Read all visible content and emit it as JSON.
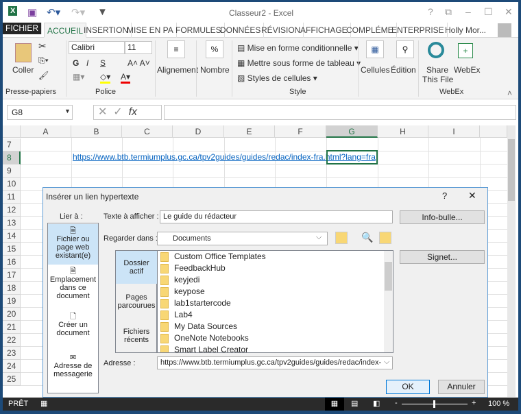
{
  "window": {
    "title": "Classeur2 - Excel",
    "controls": [
      "?",
      "⧉",
      "–",
      "☐",
      "✕"
    ]
  },
  "tabs": [
    "FICHIER",
    "ACCUEIL",
    "INSERTION",
    "MISE EN PA",
    "FORMULES",
    "DONNÉES",
    "RÉVISION",
    "AFFICHAGE",
    "COMPLÉME",
    "ENTERPRISE"
  ],
  "user": "Holly Mor...",
  "ribbon": {
    "paste": "Coller",
    "clipboard_group": "Presse-papiers",
    "font": "Calibri",
    "size": "11",
    "font_group": "Police",
    "bold": "G",
    "italic": "I",
    "underline": "S",
    "alignment": "Alignement",
    "number": "Nombre",
    "cond_format": "Mise en forme conditionnelle",
    "table_format": "Mettre sous forme de tableau",
    "cell_styles": "Styles de cellules",
    "style_group": "Style",
    "cells": "Cellules",
    "editing": "Édition",
    "share1": "Share",
    "share2": "This File",
    "webex": "WebEx",
    "webex_group": "WebEx"
  },
  "formula_bar": {
    "name_box": "G8",
    "value": ""
  },
  "columns": [
    "A",
    "B",
    "C",
    "D",
    "E",
    "F",
    "G",
    "H",
    "I"
  ],
  "rows": [
    "7",
    "8",
    "9",
    "10",
    "11",
    "12",
    "13",
    "14",
    "15",
    "16",
    "17",
    "18",
    "19",
    "20",
    "21",
    "22",
    "23",
    "24",
    "25"
  ],
  "cell_b8": "https://www.btb.termiumplus.gc.ca/tpv2guides/guides/redac/index-fra.html?lang=fra",
  "dialog": {
    "title": "Insérer un lien hypertexte",
    "help": "?",
    "close": "✕",
    "link_to": "Lier à :",
    "link_items": [
      [
        "Fichier ou",
        "page web",
        "existant(e)"
      ],
      [
        "Emplacement",
        "dans ce",
        "document"
      ],
      [
        "Créer un",
        "document"
      ],
      [
        "Adresse de",
        "messagerie"
      ]
    ],
    "text_label": "Texte à afficher :",
    "text_value": "Le guide du rédacteur",
    "tooltip_btn": "Info-bulle...",
    "look_in_label": "Regarder dans :",
    "look_in_value": "Documents",
    "nav": [
      [
        "Dossier",
        "actif"
      ],
      [
        "Pages",
        "parcourues"
      ],
      [
        "Fichiers",
        "récents"
      ]
    ],
    "files": [
      "Custom Office Templates",
      "FeedbackHub",
      "keyjedi",
      "keypose",
      "lab1startercode",
      "Lab4",
      "My Data Sources",
      "OneNote Notebooks",
      "Smart Label Creator"
    ],
    "bookmark_btn": "Signet...",
    "address_label": "Adresse :",
    "address_value": "https://www.btb.termiumplus.gc.ca/tpv2guides/guides/redac/index-",
    "ok": "OK",
    "cancel": "Annuler"
  },
  "status": {
    "ready": "PRÊT",
    "zoom": "100 %",
    "zoom_level": 100
  }
}
